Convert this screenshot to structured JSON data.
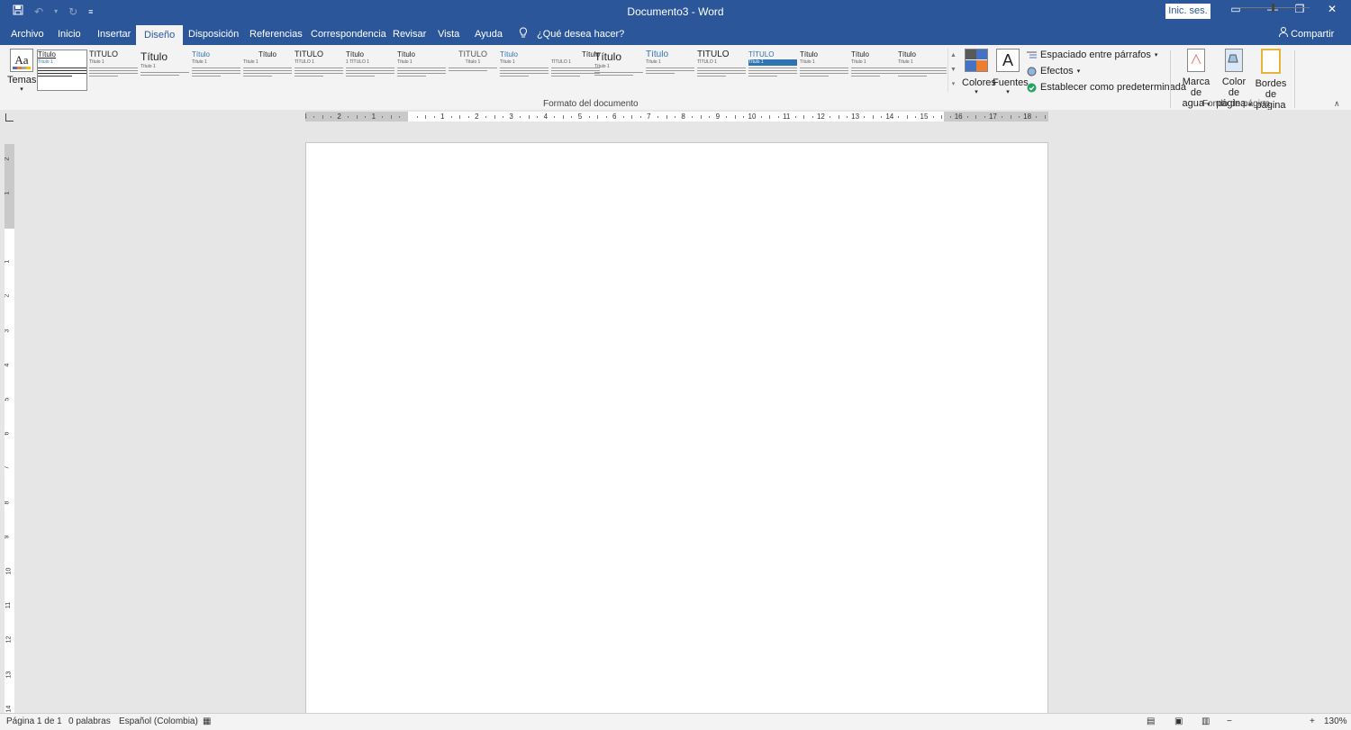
{
  "titlebar": {
    "document_title": "Documento3 - Word",
    "signin_label": "Inic. ses.",
    "qat_icons": [
      "save-icon",
      "undo-icon",
      "redo-icon",
      "customize-icon"
    ]
  },
  "tabs": [
    {
      "label": "Archivo"
    },
    {
      "label": "Inicio"
    },
    {
      "label": "Insertar"
    },
    {
      "label": "Diseño",
      "active": true
    },
    {
      "label": "Disposición"
    },
    {
      "label": "Referencias"
    },
    {
      "label": "Correspondencia"
    },
    {
      "label": "Revisar"
    },
    {
      "label": "Vista"
    },
    {
      "label": "Ayuda"
    }
  ],
  "tell_me": "¿Qué desea hacer?",
  "share_label": "Compartir",
  "ribbon": {
    "temas_label": "Temas",
    "temas_icon_text": "Aa",
    "gallery": [
      {
        "title": "Título",
        "sub": "Título 1"
      },
      {
        "title": "TÍTULO",
        "sub": "Título 1"
      },
      {
        "title": "Título",
        "sub": "Título 1"
      },
      {
        "title": "Título",
        "sub": "Título 1"
      },
      {
        "title": "Título",
        "sub": "Título 1"
      },
      {
        "title": "TÍTULO",
        "sub": "TÍTULO 1"
      },
      {
        "title": "Título",
        "sub": "1 TÍTULO 1"
      },
      {
        "title": "Título",
        "sub": "Título 1"
      },
      {
        "title": "TÍTULO",
        "sub": "Título 1"
      },
      {
        "title": "Título",
        "sub": "Título 1"
      },
      {
        "title": "Título",
        "sub": "TÍTULO 1"
      },
      {
        "title": "Título",
        "sub": "Título 1"
      },
      {
        "title": "Título",
        "sub": "Título 1"
      },
      {
        "title": "TÍTULO",
        "sub": "TÍTULO 1"
      },
      {
        "title": "TÍTULO",
        "sub": "Título 1"
      },
      {
        "title": "Título",
        "sub": "Título 1"
      },
      {
        "title": "Título",
        "sub": "Título 1"
      },
      {
        "title": "Título",
        "sub": "Título 1"
      }
    ],
    "colores_label": "Colores",
    "fuentes_label": "Fuentes",
    "fuentes_icon_text": "A",
    "espaciado_label": "Espaciado entre párrafos",
    "efectos_label": "Efectos",
    "establecer_label": "Establecer como predeterminada",
    "formato_group_label": "Formato del documento",
    "marca_label_1": "Marca de",
    "marca_label_2": "agua",
    "color_label_1": "Color de",
    "color_label_2": "página",
    "bordes_label_1": "Bordes",
    "bordes_label_2": "de página",
    "fondo_group_label": "Fondo de página",
    "colors": {
      "theme1": "#595959",
      "theme2": "#4472c4",
      "theme3": "#ed7d31",
      "theme4": "#a5a5a5"
    }
  },
  "ruler": {
    "numbers": [
      "3",
      "2",
      "1",
      "1",
      "2",
      "3",
      "4",
      "5",
      "6",
      "7",
      "8",
      "9",
      "10",
      "11",
      "12",
      "13",
      "14",
      "15",
      "16",
      "17",
      "18"
    ]
  },
  "vruler": {
    "numbers": [
      "2",
      "1",
      "1",
      "2",
      "3",
      "4",
      "5",
      "6",
      "7",
      "8",
      "9",
      "10",
      "11",
      "12",
      "13",
      "14"
    ]
  },
  "status": {
    "page": "Página 1 de 1",
    "words": "0 palabras",
    "language": "Español (Colombia)",
    "zoom": "130%"
  },
  "colors": {
    "accent": "#2b579a"
  }
}
